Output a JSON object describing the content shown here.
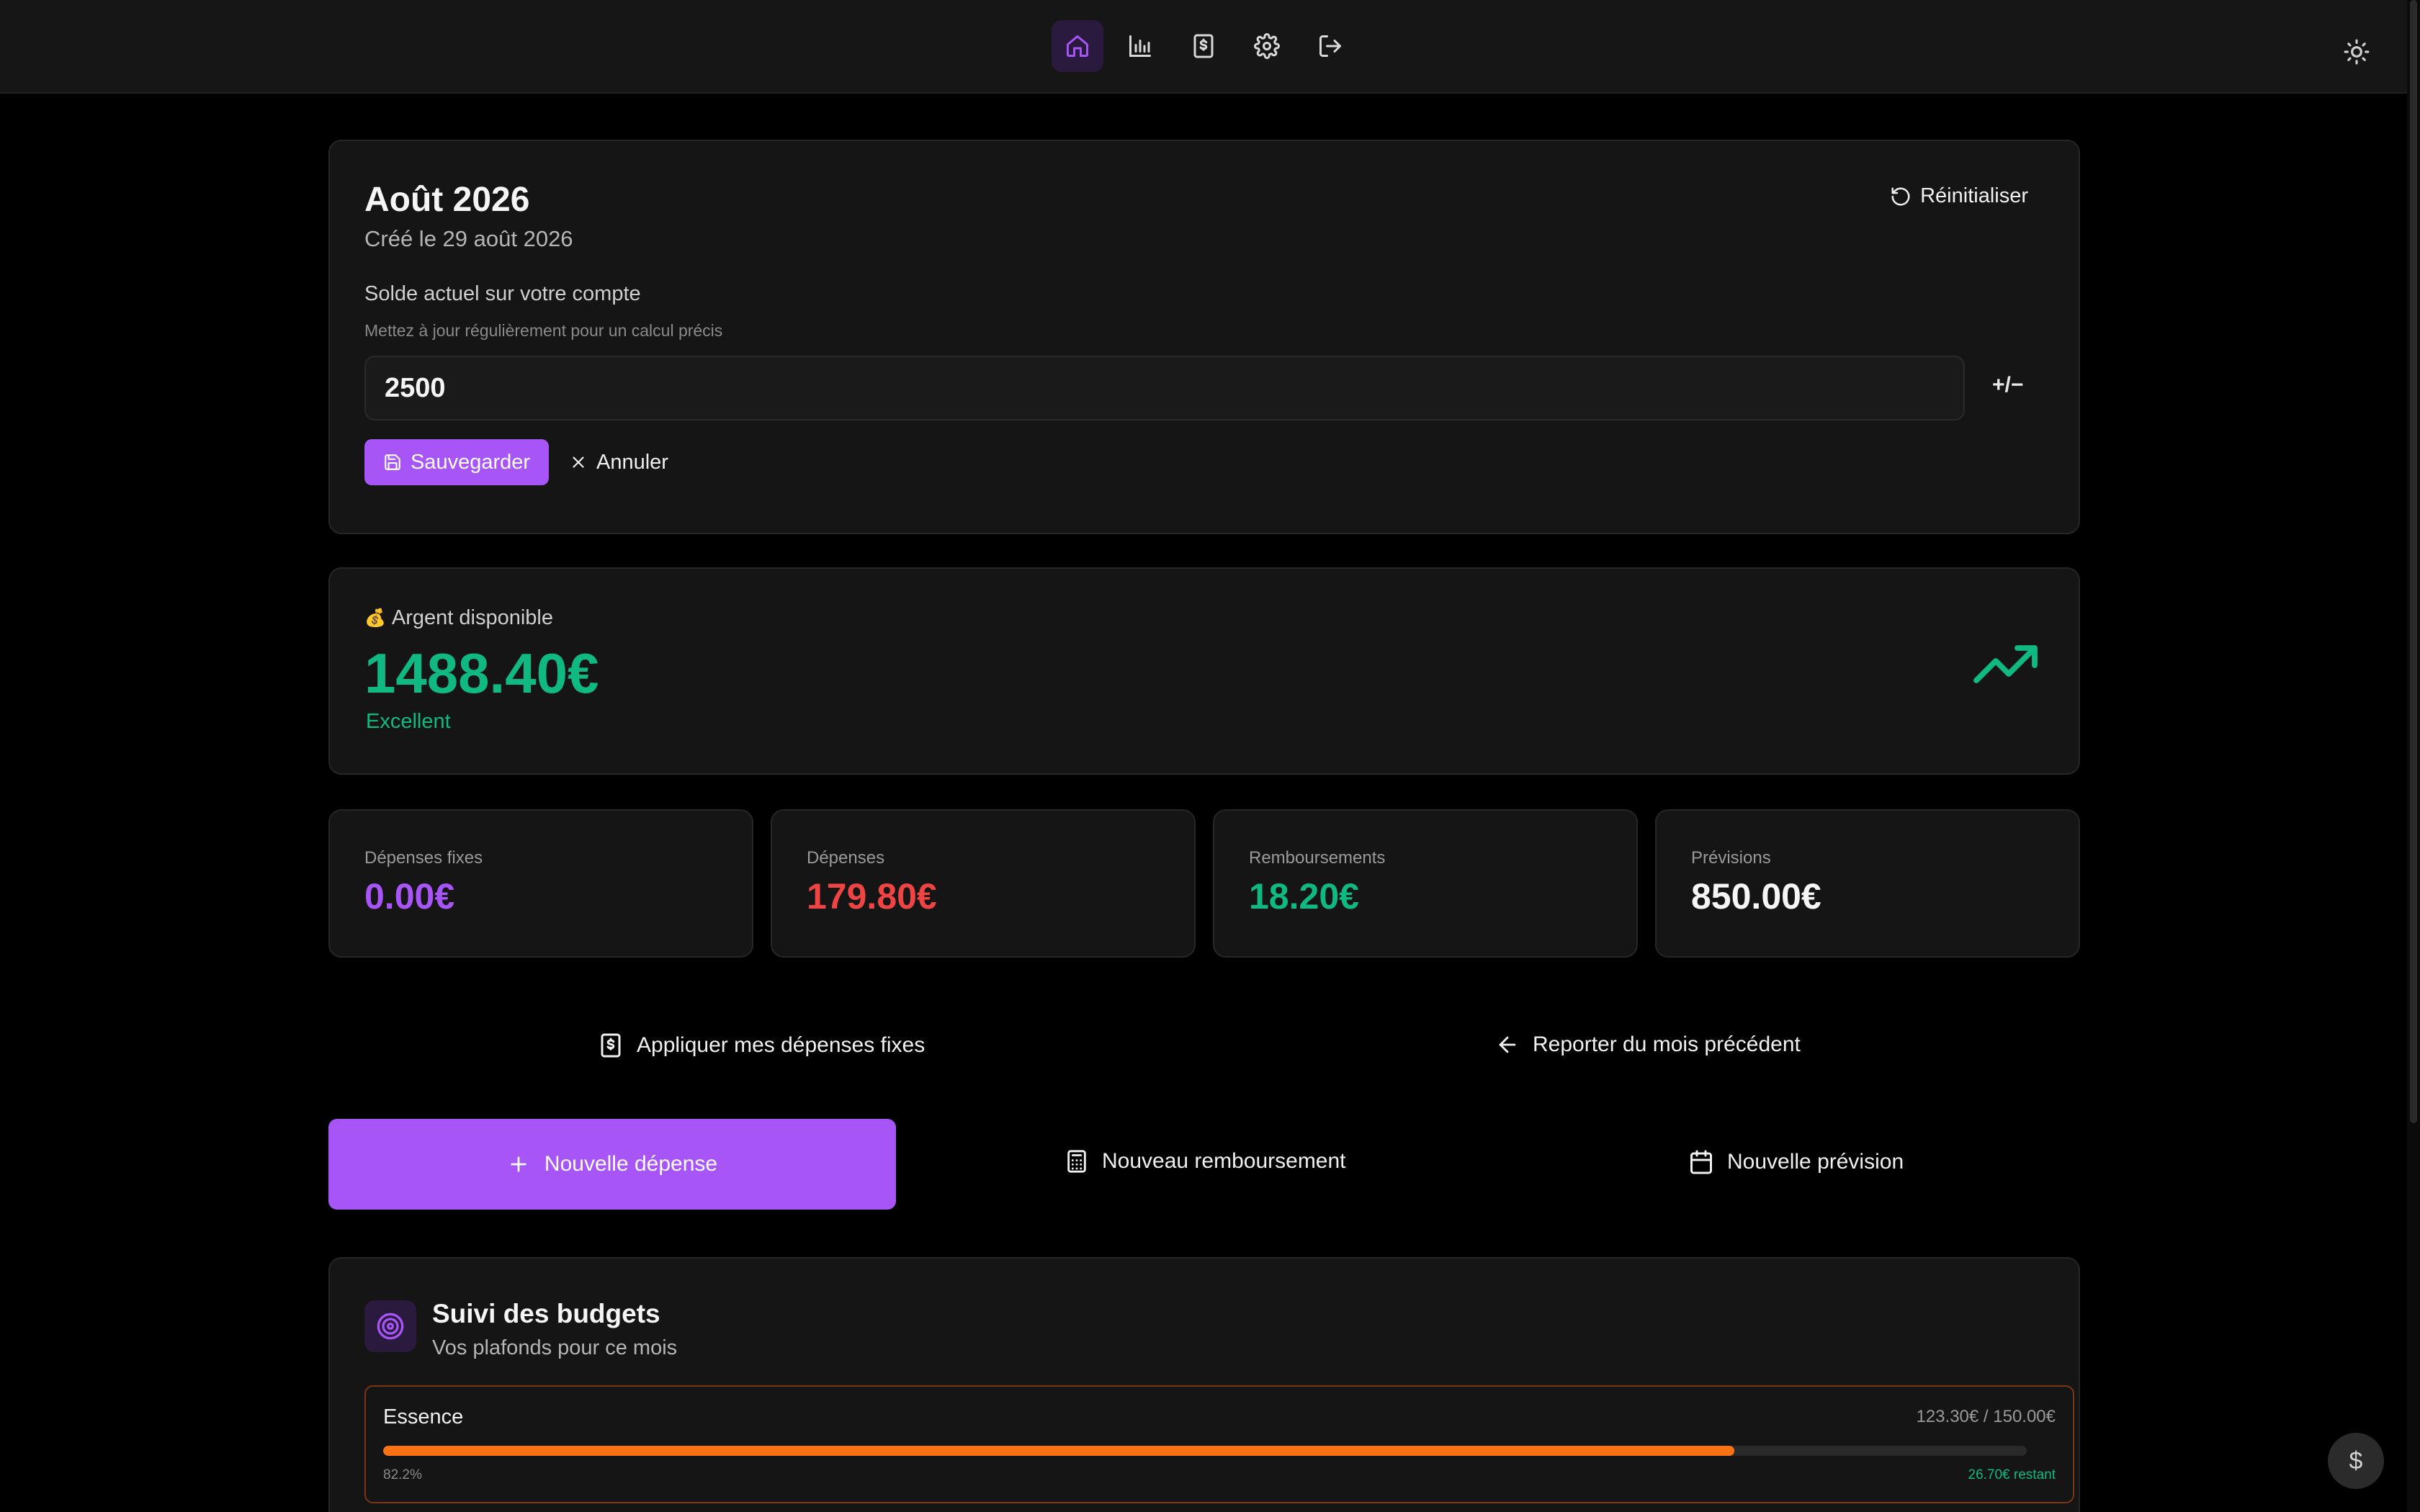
{
  "nav": {
    "items": [
      {
        "name": "home-icon",
        "active": true
      },
      {
        "name": "bar-chart-icon",
        "active": false
      },
      {
        "name": "receipt-dollar-icon",
        "active": false
      },
      {
        "name": "gear-icon",
        "active": false
      },
      {
        "name": "logout-icon",
        "active": false
      }
    ],
    "theme_icon": "sun-icon"
  },
  "month": {
    "title": "Août 2026",
    "created": "Créé le 29 août 2026",
    "reset_label": "Réinitialiser",
    "balance_label": "Solde actuel sur votre compte",
    "balance_hint": "Mettez à jour régulièrement pour un calcul précis",
    "balance_value": "2500",
    "plusminus_label": "+/−",
    "save_label": "Sauvegarder",
    "cancel_label": "Annuler"
  },
  "available": {
    "emoji": "💰",
    "label": "Argent disponible",
    "value": "1488.40€",
    "status": "Excellent"
  },
  "stats": [
    {
      "label": "Dépenses fixes",
      "value": "0.00€",
      "color": "#a855f7"
    },
    {
      "label": "Dépenses",
      "value": "179.80€",
      "color": "#ef4444"
    },
    {
      "label": "Remboursements",
      "value": "18.20€",
      "color": "#10b981"
    },
    {
      "label": "Prévisions",
      "value": "850.00€",
      "color": "#f5f5f5"
    }
  ],
  "actions": {
    "apply_fixed": "Appliquer mes dépenses fixes",
    "carry_over": "Reporter du mois précédent",
    "new_expense": "Nouvelle dépense",
    "new_refund": "Nouveau remboursement",
    "new_forecast": "Nouvelle prévision"
  },
  "budgets": {
    "title": "Suivi des budgets",
    "subtitle": "Vos plafonds pour ce mois",
    "items": [
      {
        "name": "Essence",
        "amount": "123.30€ / 150.00€",
        "percent_label": "82.2%",
        "progress": 0.822,
        "remaining": "26.70€ restant",
        "color": "#f97316"
      }
    ]
  },
  "fab": {
    "label": "$"
  },
  "colors": {
    "accent": "#a855f7",
    "positive": "#10b981",
    "negative": "#ef4444",
    "warning": "#f97316"
  }
}
